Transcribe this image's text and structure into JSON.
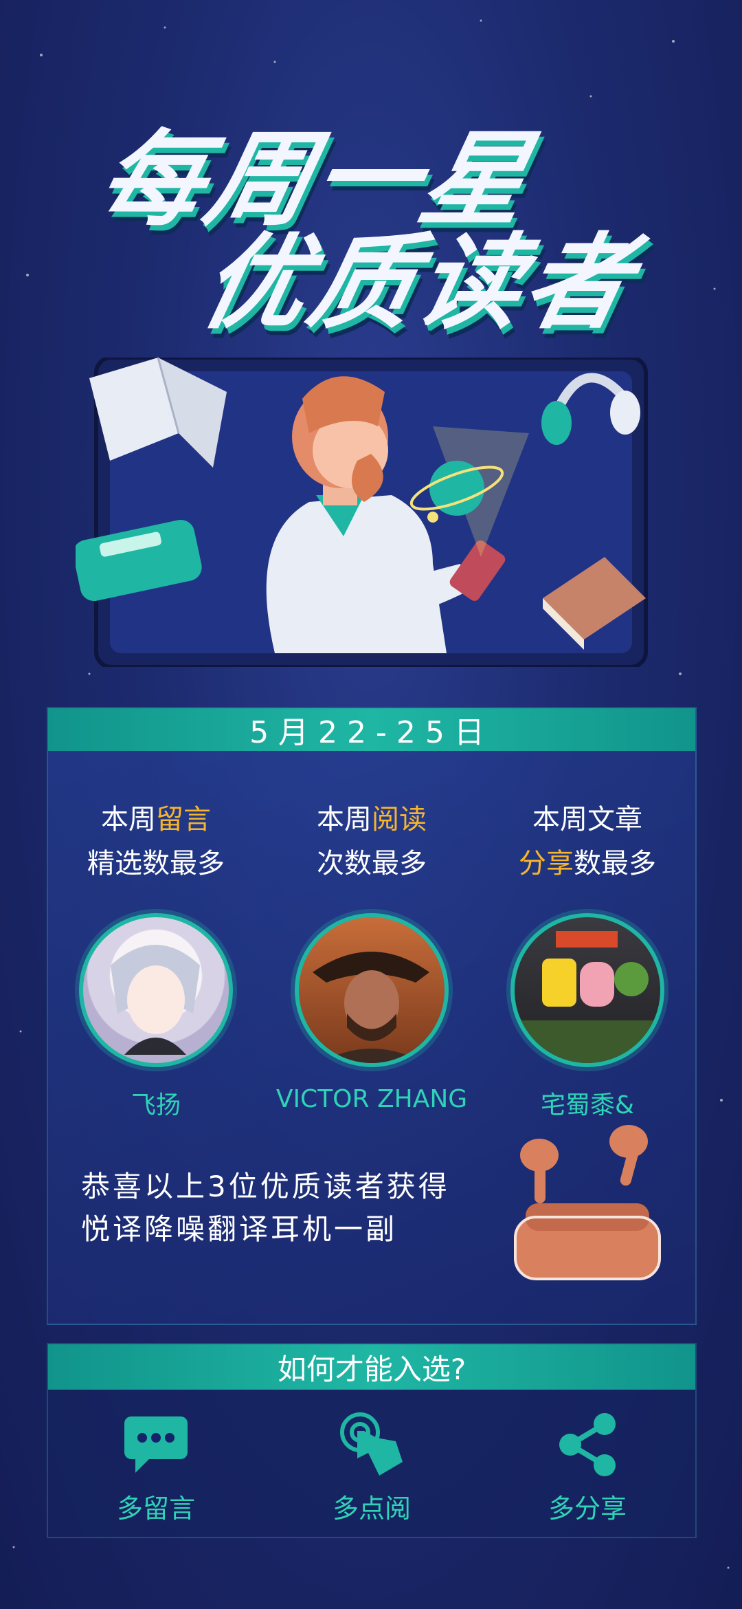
{
  "title": {
    "line1": "每周一星",
    "line2": "优质读者"
  },
  "date_banner": "5月22-25日",
  "categories": [
    {
      "line1_prefix": "本周",
      "line1_highlight": "留言",
      "line2": "精选数最多",
      "reader": "飞扬"
    },
    {
      "line1_prefix": "本周",
      "line1_highlight": "阅读",
      "line2": "次数最多",
      "reader": "VICTOR ZHANG"
    },
    {
      "line1": "本周文章",
      "line2_highlight": "分享",
      "line2_suffix": "数最多",
      "reader": "宅蜀黍&"
    }
  ],
  "prize": {
    "line1": "恭喜以上3位优质读者获得",
    "line2": "悦译降噪翻译耳机一副"
  },
  "how": {
    "heading": "如何才能入选?",
    "items": [
      {
        "label": "多留言",
        "icon": "chat-icon"
      },
      {
        "label": "多点阅",
        "icon": "tap-icon"
      },
      {
        "label": "多分享",
        "icon": "share-icon"
      }
    ]
  },
  "colors": {
    "accent": "#1fb6a4",
    "highlight": "#f7b52c",
    "background": "#1c2a6e"
  }
}
